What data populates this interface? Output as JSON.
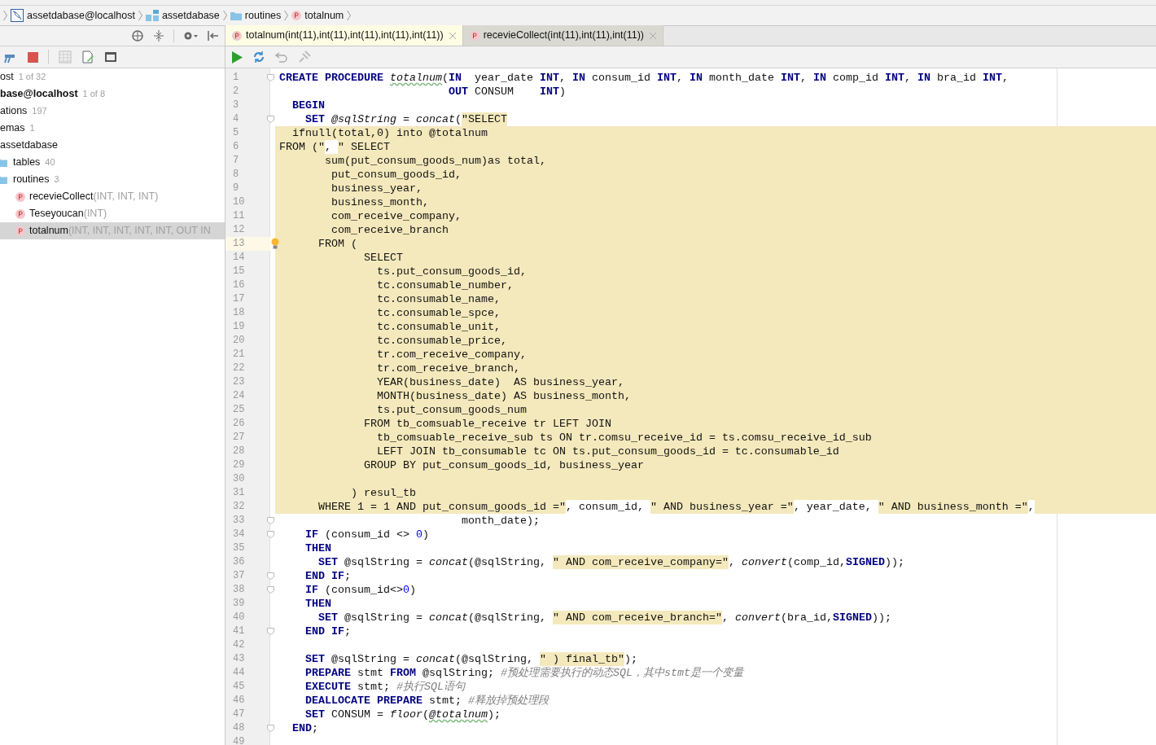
{
  "breadcrumb": [
    {
      "kind": "datasource",
      "label": "assetdabase@localhost"
    },
    {
      "kind": "schema",
      "label": "assetdabase"
    },
    {
      "kind": "folder",
      "label": "routines"
    },
    {
      "kind": "procedure",
      "label": "totalnum"
    }
  ],
  "tree": [
    {
      "name": "ost",
      "count": "1 of 32",
      "active": false,
      "selected": false
    },
    {
      "name": "base@localhost",
      "count": "1 of 8",
      "active": true,
      "selected": false
    },
    {
      "name": "ations",
      "count": "197",
      "active": false,
      "selected": false
    },
    {
      "name": "emas",
      "count": "1",
      "active": false,
      "selected": false
    },
    {
      "name": "assetdabase",
      "active": false,
      "selected": false,
      "children": [
        {
          "kind": "folder",
          "name": "tables",
          "count": "40",
          "selected": false
        },
        {
          "kind": "folder",
          "name": "routines",
          "count": "3",
          "selected": false,
          "children": [
            {
              "kind": "procedure",
              "name": "recevieCollect",
              "params": "(INT, INT, INT)",
              "selected": false
            },
            {
              "kind": "procedure",
              "name": "Teseyoucan",
              "params": "(INT)",
              "selected": false
            },
            {
              "kind": "procedure",
              "name": "totalnum",
              "params": "(INT, INT, INT, INT, INT, OUT IN",
              "selected": true
            }
          ]
        }
      ]
    }
  ],
  "tabs": [
    {
      "label": "totalnum(int(11),int(11),int(11),int(11),int(11))",
      "selected": true
    },
    {
      "label": "recevieCollect(int(11),int(11),int(11))",
      "selected": false
    }
  ],
  "lines": [
    {
      "number": "1",
      "fold": true,
      "segments": [
        {
          "kind": "kw",
          "text": "CREATE PROCEDURE "
        },
        {
          "kind": "fnw",
          "text": "totalnum"
        },
        {
          "kind": "id",
          "text": "("
        },
        {
          "kind": "kw",
          "text": "IN"
        },
        {
          "kind": "id",
          "text": "  year_date "
        },
        {
          "kind": "kw",
          "text": "INT"
        },
        {
          "kind": "id",
          "text": ", "
        },
        {
          "kind": "kw",
          "text": "IN"
        },
        {
          "kind": "id",
          "text": " consum_id "
        },
        {
          "kind": "kw",
          "text": "INT"
        },
        {
          "kind": "id",
          "text": ", "
        },
        {
          "kind": "kw",
          "text": "IN"
        },
        {
          "kind": "id",
          "text": " month_date "
        },
        {
          "kind": "kw",
          "text": "INT"
        },
        {
          "kind": "id",
          "text": ", "
        },
        {
          "kind": "kw",
          "text": "IN"
        },
        {
          "kind": "id",
          "text": " comp_id "
        },
        {
          "kind": "kw",
          "text": "INT"
        },
        {
          "kind": "id",
          "text": ", "
        },
        {
          "kind": "kw",
          "text": "IN"
        },
        {
          "kind": "id",
          "text": " bra_id "
        },
        {
          "kind": "kw",
          "text": "INT"
        },
        {
          "kind": "id",
          "text": ","
        }
      ]
    },
    {
      "number": "2",
      "segments": [
        {
          "kind": "kw",
          "text": "                          OUT"
        },
        {
          "kind": "id",
          "text": " CONSUM    "
        },
        {
          "kind": "kw",
          "text": "INT"
        },
        {
          "kind": "id",
          "text": ")"
        }
      ]
    },
    {
      "number": "3",
      "segments": [
        {
          "kind": "kw",
          "text": "  BEGIN"
        }
      ]
    },
    {
      "number": "4",
      "fold": true,
      "segments": [
        {
          "kind": "kw",
          "text": "    SET"
        },
        {
          "kind": "fn",
          "text": " @sqlString"
        },
        {
          "kind": "id",
          "text": " = "
        },
        {
          "kind": "fn",
          "text": "concat"
        },
        {
          "kind": "id",
          "text": "("
        },
        {
          "kind": "str",
          "text": "\"SELECT"
        }
      ]
    },
    {
      "number": "5",
      "injected": true,
      "segments": [
        {
          "kind": "id",
          "text": "  ifnull(total,0) into @totalnum"
        }
      ]
    },
    {
      "number": "6",
      "injected": true,
      "segments": [
        {
          "kind": "id",
          "text": "FROM (\""
        },
        {
          "kind": "gap",
          "text": ", "
        },
        {
          "kind": "id",
          "text": "\" SELECT"
        }
      ]
    },
    {
      "number": "7",
      "injected": true,
      "segments": [
        {
          "kind": "id",
          "text": "       sum(put_consum_goods_num)as total,"
        }
      ]
    },
    {
      "number": "8",
      "injected": true,
      "segments": [
        {
          "kind": "id",
          "text": "        put_consum_goods_id,"
        }
      ]
    },
    {
      "number": "9",
      "injected": true,
      "segments": [
        {
          "kind": "id",
          "text": "        business_year,"
        }
      ]
    },
    {
      "number": "10",
      "injected": true,
      "segments": [
        {
          "kind": "id",
          "text": "        business_month,"
        }
      ]
    },
    {
      "number": "11",
      "injected": true,
      "segments": [
        {
          "kind": "id",
          "text": "        com_receive_company,"
        }
      ]
    },
    {
      "number": "12",
      "injected": true,
      "segments": [
        {
          "kind": "id",
          "text": "        com_receive_branch"
        }
      ]
    },
    {
      "number": "13",
      "injected": true,
      "current": true,
      "bulb": true,
      "segments": [
        {
          "kind": "id",
          "text": "      FROM ("
        }
      ]
    },
    {
      "number": "14",
      "injected": true,
      "segments": [
        {
          "kind": "id",
          "text": "             SELECT"
        }
      ]
    },
    {
      "number": "15",
      "injected": true,
      "segments": [
        {
          "kind": "id",
          "text": "               ts.put_consum_goods_id,"
        }
      ]
    },
    {
      "number": "16",
      "injected": true,
      "segments": [
        {
          "kind": "id",
          "text": "               tc.consumable_number,"
        }
      ]
    },
    {
      "number": "17",
      "injected": true,
      "segments": [
        {
          "kind": "id",
          "text": "               tc.consumable_name,"
        }
      ]
    },
    {
      "number": "18",
      "injected": true,
      "segments": [
        {
          "kind": "id",
          "text": "               tc.consumable_spce,"
        }
      ]
    },
    {
      "number": "19",
      "injected": true,
      "segments": [
        {
          "kind": "id",
          "text": "               tc.consumable_unit,"
        }
      ]
    },
    {
      "number": "20",
      "injected": true,
      "segments": [
        {
          "kind": "id",
          "text": "               tc.consumable_price,"
        }
      ]
    },
    {
      "number": "21",
      "injected": true,
      "segments": [
        {
          "kind": "id",
          "text": "               tr.com_receive_company,"
        }
      ]
    },
    {
      "number": "22",
      "injected": true,
      "segments": [
        {
          "kind": "id",
          "text": "               tr.com_receive_branch,"
        }
      ]
    },
    {
      "number": "23",
      "injected": true,
      "segments": [
        {
          "kind": "id",
          "text": "               YEAR(business_date)  AS business_year,"
        }
      ]
    },
    {
      "number": "24",
      "injected": true,
      "segments": [
        {
          "kind": "id",
          "text": "               MONTH(business_date) AS business_month,"
        }
      ]
    },
    {
      "number": "25",
      "injected": true,
      "segments": [
        {
          "kind": "id",
          "text": "               ts.put_consum_goods_num"
        }
      ]
    },
    {
      "number": "26",
      "injected": true,
      "segments": [
        {
          "kind": "id",
          "text": "             FROM tb_comsuable_receive tr LEFT JOIN"
        }
      ]
    },
    {
      "number": "27",
      "injected": true,
      "segments": [
        {
          "kind": "id",
          "text": "               tb_comsuable_receive_sub ts ON tr.comsu_receive_id = ts.comsu_receive_id_sub"
        }
      ]
    },
    {
      "number": "28",
      "injected": true,
      "segments": [
        {
          "kind": "id",
          "text": "               LEFT JOIN tb_consumable tc ON ts.put_consum_goods_id = tc.consumable_id"
        }
      ]
    },
    {
      "number": "29",
      "injected": true,
      "segments": [
        {
          "kind": "id",
          "text": "             GROUP BY put_consum_goods_id, business_year"
        }
      ]
    },
    {
      "number": "30",
      "injected": true
    },
    {
      "number": "31",
      "injected": true,
      "segments": [
        {
          "kind": "id",
          "text": "           ) resul_tb"
        }
      ]
    },
    {
      "number": "32",
      "injected": true,
      "segments": [
        {
          "kind": "id",
          "text": "      WHERE 1 = 1 AND put_consum_goods_id =\""
        },
        {
          "kind": "gap",
          "text": ", consum_id, "
        },
        {
          "kind": "id",
          "text": "\" AND business_year =\""
        },
        {
          "kind": "gap",
          "text": ", year_date, "
        },
        {
          "kind": "id",
          "text": "\" AND business_month =\""
        },
        {
          "kind": "gap",
          "text": ","
        }
      ]
    },
    {
      "number": "33",
      "fold": true,
      "segments": [
        {
          "kind": "id",
          "text": "                            month_date);"
        }
      ]
    },
    {
      "number": "34",
      "fold": true,
      "segments": [
        {
          "kind": "kw",
          "text": "    IF"
        },
        {
          "kind": "id",
          "text": " (consum_id <> "
        },
        {
          "kind": "num",
          "text": "0"
        },
        {
          "kind": "id",
          "text": ")"
        }
      ]
    },
    {
      "number": "35",
      "segments": [
        {
          "kind": "kw",
          "text": "    THEN"
        }
      ]
    },
    {
      "number": "36",
      "segments": [
        {
          "kind": "kw",
          "text": "      SET"
        },
        {
          "kind": "id",
          "text": " @sqlString = "
        },
        {
          "kind": "fn",
          "text": "concat"
        },
        {
          "kind": "id",
          "text": "(@sqlString, "
        },
        {
          "kind": "str",
          "text": "\" AND com_receive_company=\""
        },
        {
          "kind": "id",
          "text": ", "
        },
        {
          "kind": "fn",
          "text": "convert"
        },
        {
          "kind": "id",
          "text": "(comp_id,"
        },
        {
          "kind": "kw",
          "text": "SIGNED"
        },
        {
          "kind": "id",
          "text": "));"
        }
      ]
    },
    {
      "number": "37",
      "fold": true,
      "segments": [
        {
          "kind": "kw",
          "text": "    END IF"
        },
        {
          "kind": "id",
          "text": ";"
        }
      ]
    },
    {
      "number": "38",
      "fold": true,
      "segments": [
        {
          "kind": "kw",
          "text": "    IF"
        },
        {
          "kind": "id",
          "text": " (consum_id<>"
        },
        {
          "kind": "num",
          "text": "0"
        },
        {
          "kind": "id",
          "text": ")"
        }
      ]
    },
    {
      "number": "39",
      "segments": [
        {
          "kind": "kw",
          "text": "    THEN"
        }
      ]
    },
    {
      "number": "40",
      "segments": [
        {
          "kind": "kw",
          "text": "      SET"
        },
        {
          "kind": "id",
          "text": " @sqlString = "
        },
        {
          "kind": "fn",
          "text": "concat"
        },
        {
          "kind": "id",
          "text": "(@sqlString, "
        },
        {
          "kind": "str",
          "text": "\" AND com_receive_branch=\""
        },
        {
          "kind": "id",
          "text": ", "
        },
        {
          "kind": "fn",
          "text": "convert"
        },
        {
          "kind": "id",
          "text": "(bra_id,"
        },
        {
          "kind": "kw",
          "text": "SIGNED"
        },
        {
          "kind": "id",
          "text": "));"
        }
      ]
    },
    {
      "number": "41",
      "fold": true,
      "segments": [
        {
          "kind": "kw",
          "text": "    END IF"
        },
        {
          "kind": "id",
          "text": ";"
        }
      ]
    },
    {
      "number": "42"
    },
    {
      "number": "43",
      "segments": [
        {
          "kind": "kw",
          "text": "    SET"
        },
        {
          "kind": "id",
          "text": " @sqlString = "
        },
        {
          "kind": "fn",
          "text": "concat"
        },
        {
          "kind": "id",
          "text": "(@sqlString, "
        },
        {
          "kind": "str",
          "text": "\" ) final_tb\""
        },
        {
          "kind": "id",
          "text": ");"
        }
      ]
    },
    {
      "number": "44",
      "segments": [
        {
          "kind": "kw",
          "text": "    PREPARE"
        },
        {
          "kind": "id",
          "text": " stmt "
        },
        {
          "kind": "kw",
          "text": "FROM"
        },
        {
          "kind": "id",
          "text": " @sqlString; "
        },
        {
          "kind": "cm",
          "text": "#预处理需要执行的动态SQL，其中stmt是一个变量"
        }
      ]
    },
    {
      "number": "45",
      "segments": [
        {
          "kind": "kw",
          "text": "    EXECUTE"
        },
        {
          "kind": "id",
          "text": " stmt; "
        },
        {
          "kind": "cm",
          "text": "#执行SQL语句"
        }
      ]
    },
    {
      "number": "46",
      "segments": [
        {
          "kind": "kw",
          "text": "    DEALLOCATE PREPARE"
        },
        {
          "kind": "id",
          "text": " stmt; "
        },
        {
          "kind": "cm",
          "text": "#释放掉预处理段"
        }
      ]
    },
    {
      "number": "47",
      "segments": [
        {
          "kind": "kw",
          "text": "    SET"
        },
        {
          "kind": "id",
          "text": " CONSUM = "
        },
        {
          "kind": "fn",
          "text": "floor"
        },
        {
          "kind": "id",
          "text": "("
        },
        {
          "kind": "fnw",
          "text": "@totalnum"
        },
        {
          "kind": "id",
          "text": ");"
        }
      ]
    },
    {
      "number": "48",
      "fold": true,
      "segments": [
        {
          "kind": "kw",
          "text": "  END"
        },
        {
          "kind": "id",
          "text": ";"
        }
      ]
    },
    {
      "number": "49"
    }
  ]
}
